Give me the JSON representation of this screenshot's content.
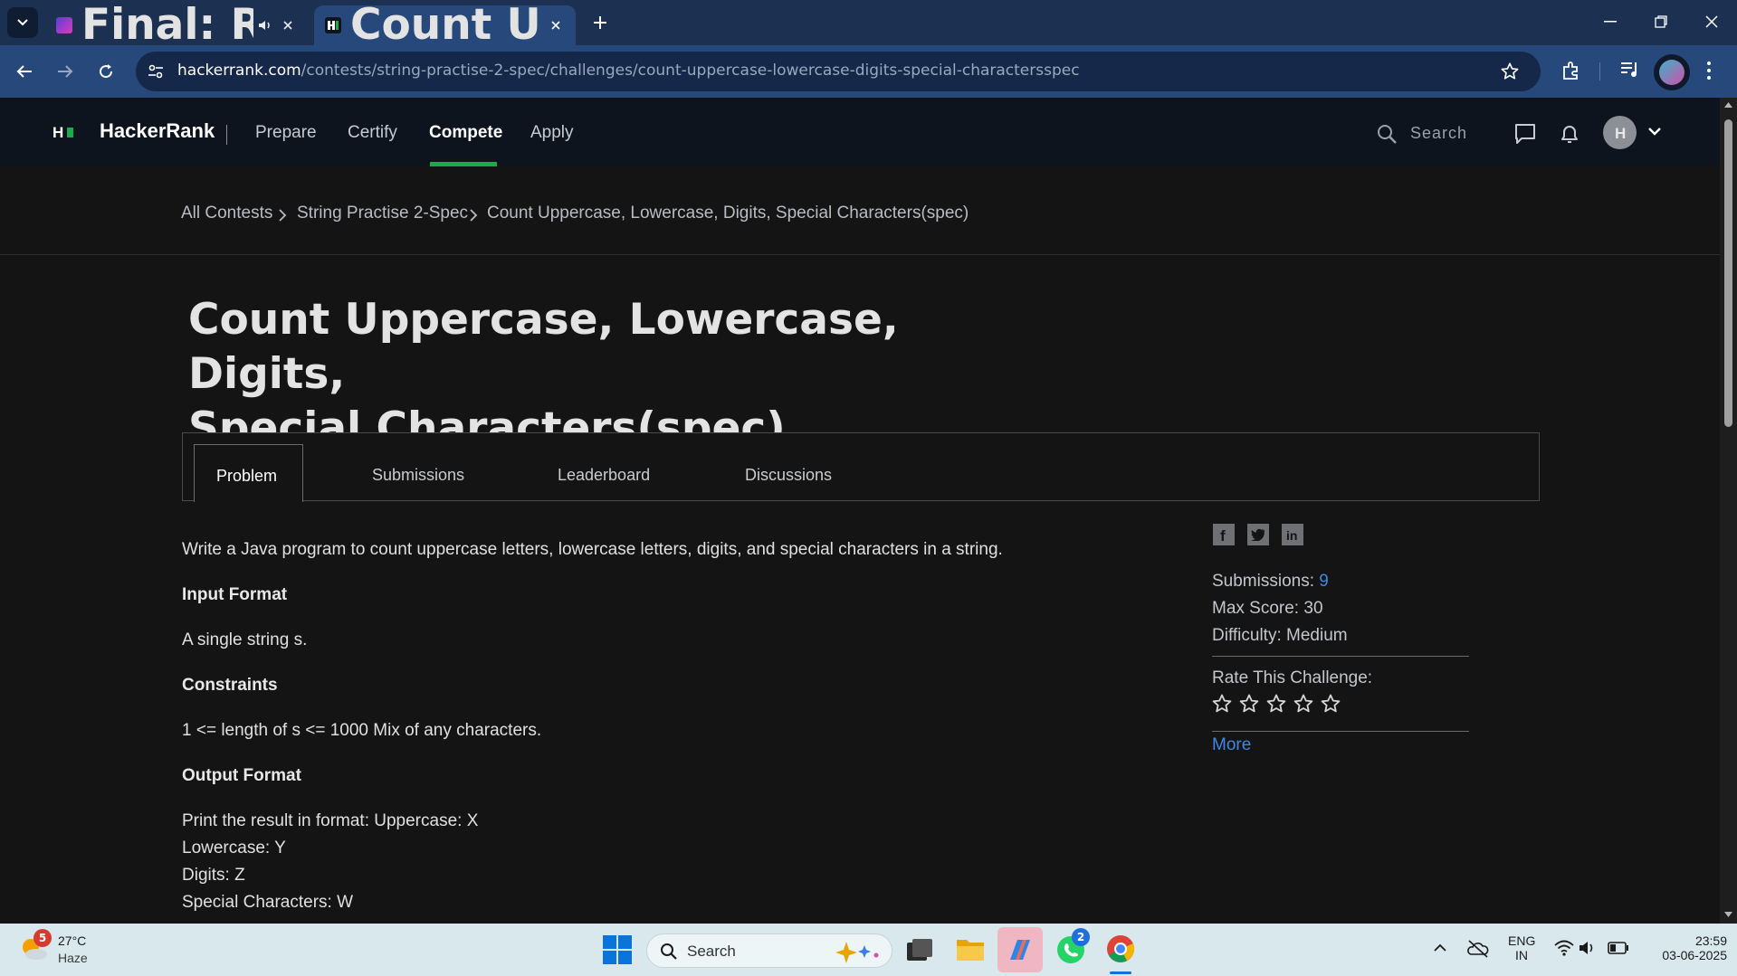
{
  "browser": {
    "tabs": [
      {
        "title": "Final: RCB vs PBKS Live vide",
        "active": false
      },
      {
        "title": "Count Uppercase, Lowercase, D",
        "active": true
      }
    ],
    "url_host": "hackerrank.com",
    "url_path": "/contests/string-practise-2-spec/challenges/count-uppercase-lowercase-digits-special-charactersspec"
  },
  "site": {
    "brand": "HackerRank",
    "logo_letter": "H",
    "nav": [
      "Prepare",
      "Certify",
      "Compete",
      "Apply"
    ],
    "active_nav": "Compete",
    "search_placeholder": "Search"
  },
  "breadcrumb": [
    "All Contests",
    "String Practise 2-Spec",
    "Count Uppercase, Lowercase, Digits, Special Characters(spec)"
  ],
  "challenge": {
    "title_line1": "Count Uppercase, Lowercase, Digits,",
    "title_line2": "Special Characters(spec)",
    "tabs": [
      "Problem",
      "Submissions",
      "Leaderboard",
      "Discussions"
    ],
    "active_tab": "Problem",
    "statement": "Write a Java program to count uppercase letters, lowercase letters, digits, and special characters in a string.",
    "input_format_heading": "Input Format",
    "input_format": "A single string s.",
    "constraints_heading": "Constraints",
    "constraints": "1 <= length of s <= 1000 Mix of any characters.",
    "output_format_heading": "Output Format",
    "output_lines": [
      "Print the result in format: Uppercase: X",
      "Lowercase: Y",
      "Digits: Z",
      "Special Characters: W"
    ]
  },
  "sidebar": {
    "submissions_label": "Submissions:",
    "submissions_value": "9",
    "max_score_label": "Max Score:",
    "max_score_value": "30",
    "difficulty_label": "Difficulty:",
    "difficulty_value": "Medium",
    "rate_label": "Rate This Challenge:",
    "stars_total": 5,
    "stars_filled": 0,
    "more_link": "More"
  },
  "taskbar": {
    "weather_temp": "27°C",
    "weather_desc": "Haze",
    "weather_badge": "5",
    "search_placeholder": "Search",
    "whatsapp_badge": "2",
    "lang_line1": "ENG",
    "lang_line2": "IN",
    "time": "23:59",
    "date": "03-06-2025"
  },
  "colors": {
    "accent_green": "#1ba94c",
    "link_blue": "#3f87e6",
    "header_bg": "#0e141e",
    "chrome_blue": "#27487a"
  }
}
